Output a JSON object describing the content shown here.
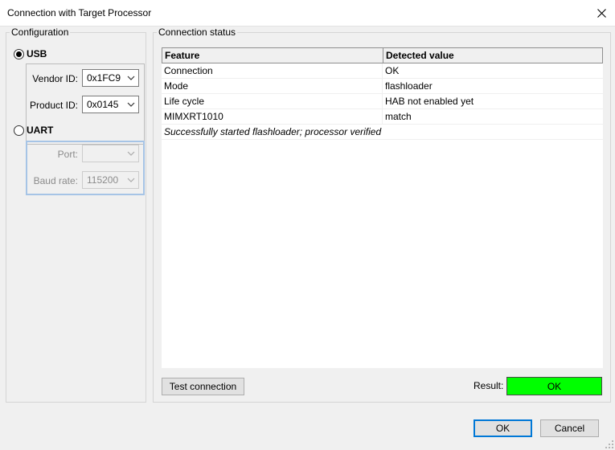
{
  "window": {
    "title": "Connection with Target Processor"
  },
  "configuration": {
    "legend": "Configuration",
    "usb": {
      "label": "USB",
      "selected": true,
      "vendor_id_label": "Vendor ID:",
      "vendor_id_value": "0x1FC9",
      "product_id_label": "Product ID:",
      "product_id_value": "0x0145"
    },
    "uart": {
      "label": "UART",
      "selected": false,
      "port_label": "Port:",
      "port_value": "",
      "baud_label": "Baud rate:",
      "baud_value": "115200"
    }
  },
  "status": {
    "legend": "Connection status",
    "columns": [
      "Feature",
      "Detected value"
    ],
    "rows": [
      {
        "feature": "Connection",
        "value": "OK"
      },
      {
        "feature": "Mode",
        "value": "flashloader"
      },
      {
        "feature": "Life cycle",
        "value": "HAB not enabled yet"
      },
      {
        "feature": "MIMXRT1010",
        "value": "match"
      }
    ],
    "note": "Successfully started flashloader; processor verified",
    "test_button": "Test connection",
    "result_label": "Result:",
    "result_value": "OK",
    "result_color": "#00ff00"
  },
  "footer": {
    "ok_label": "OK",
    "cancel_label": "Cancel"
  }
}
